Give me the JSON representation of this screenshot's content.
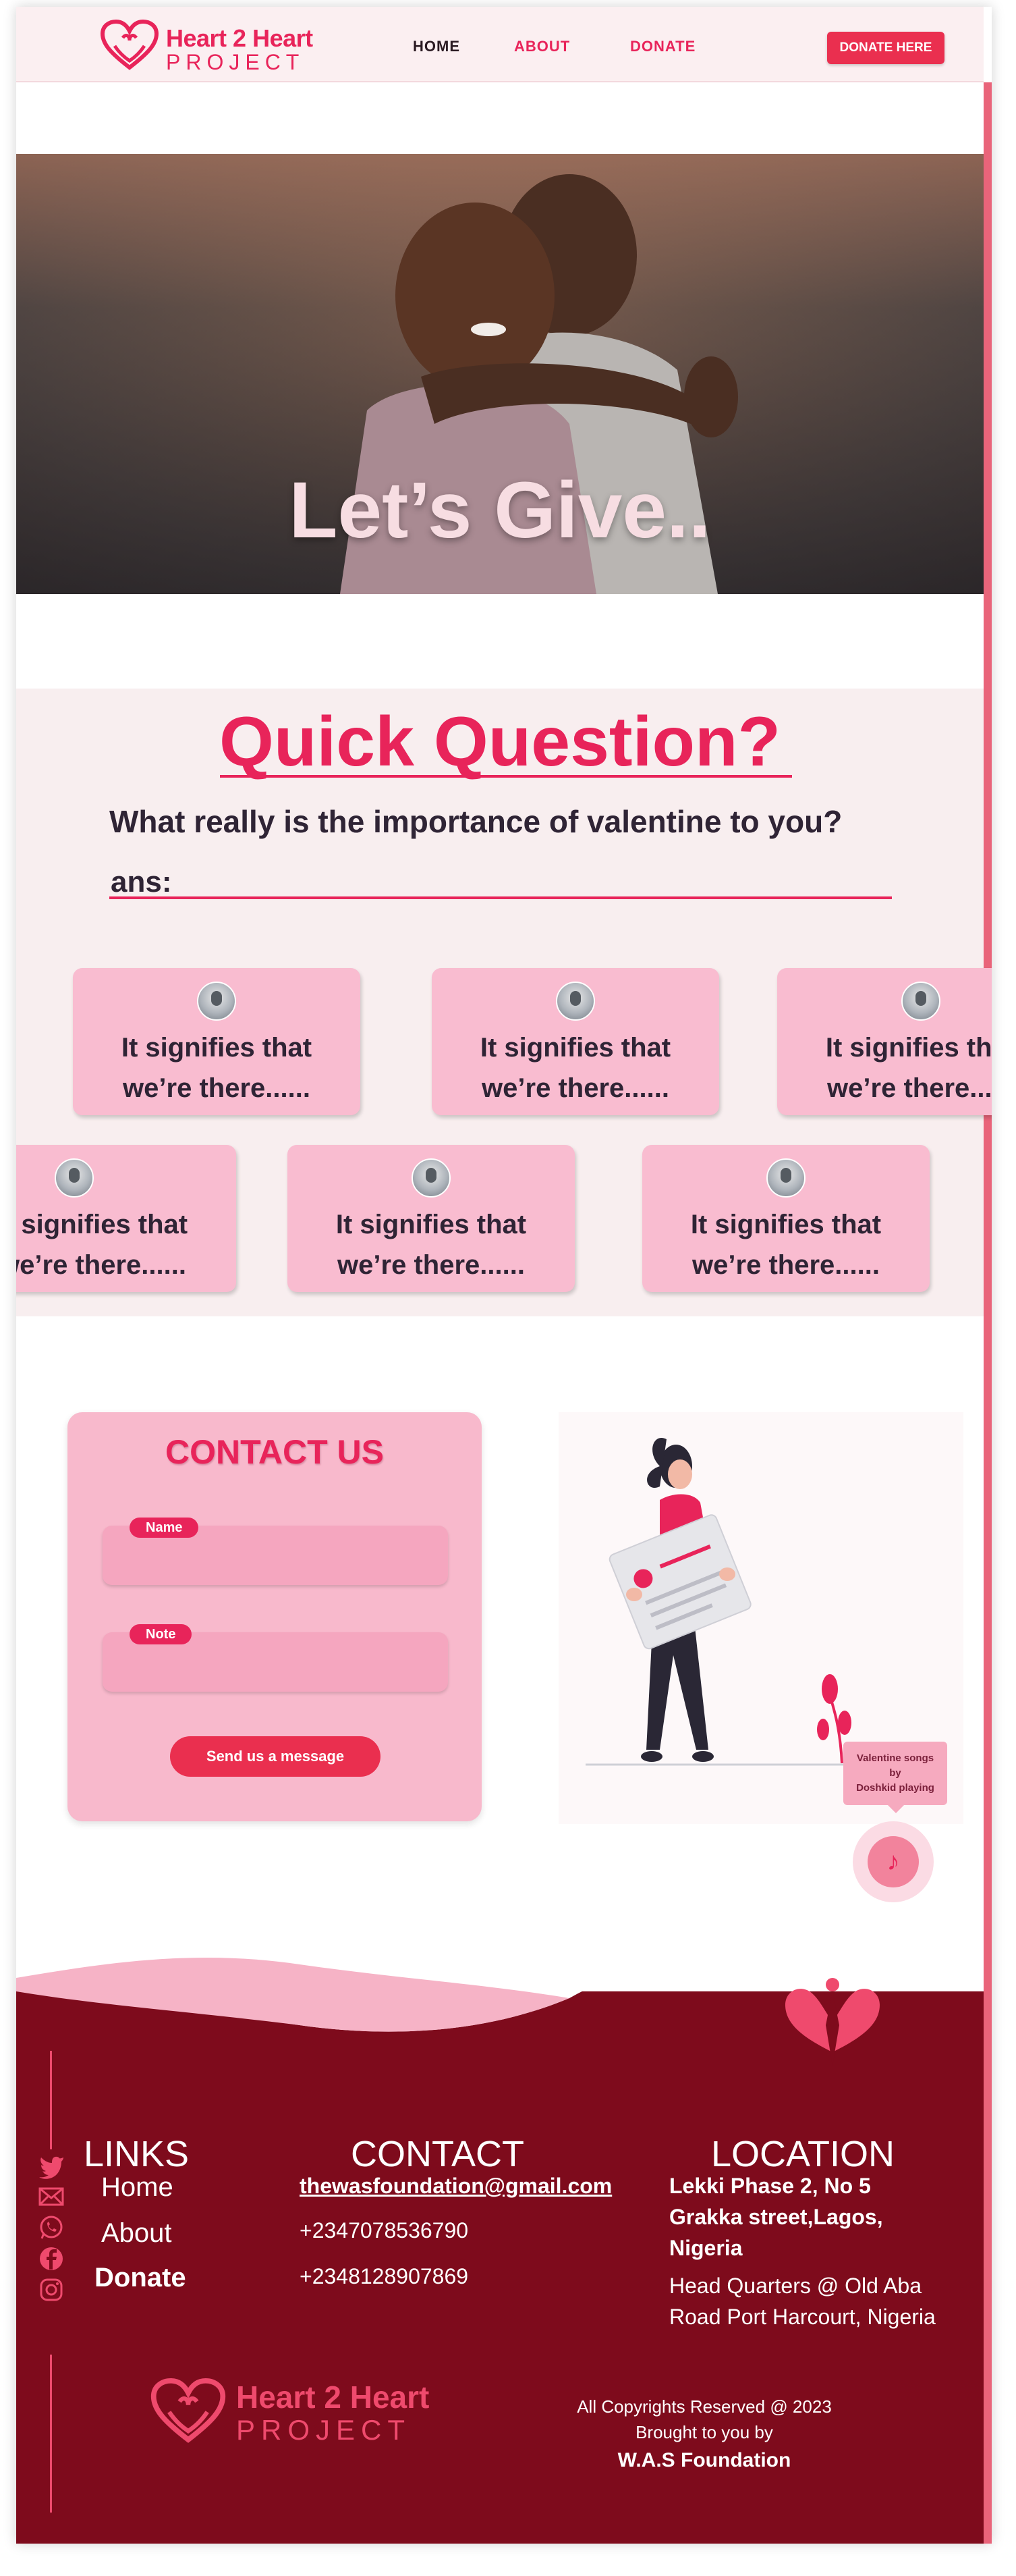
{
  "header": {
    "logo_line1": "Heart 2 Heart",
    "logo_line2": "PROJECT",
    "nav": [
      {
        "label": "HOME",
        "color": "#2a1a22"
      },
      {
        "label": "ABOUT",
        "color": "#e8245a"
      },
      {
        "label": "DONATE",
        "color": "#e8245a"
      }
    ],
    "donate_button": "DONATE HERE"
  },
  "hero": {
    "title": "Let’s Give.."
  },
  "quick_question": {
    "title": "Quick Question?",
    "question": "What really is the importance of valentine to you?",
    "answer_label": "ans:",
    "cards_row1": [
      {
        "text": "It signifies that\nwe’re there......"
      },
      {
        "text": "It signifies that\nwe’re there......"
      },
      {
        "text": "It signifies that\nwe’re there......"
      }
    ],
    "cards_row2": [
      {
        "text": "It signifies that\nwe’re there......"
      },
      {
        "text": "It signifies that\nwe’re there......"
      },
      {
        "text": "It signifies that\nwe’re there......"
      }
    ]
  },
  "contact": {
    "title": "CONTACT US",
    "name_label": "Name",
    "note_label": "Note",
    "send_button": "Send us a message"
  },
  "music_widget": {
    "line1": "Valentine songs",
    "line2": "by",
    "line3": "Doshkid  playing",
    "icon": "music-note-icon"
  },
  "footer": {
    "links_heading": "LINKS",
    "links": [
      "Home",
      "About",
      "Donate"
    ],
    "contact_heading": "CONTACT",
    "email": "thewasfoundation@gmail.com",
    "phone1": "+2347078536790",
    "phone2": "+2348128907869",
    "location_heading": "LOCATION",
    "address_line1": "Lekki Phase 2, No 5",
    "address_line2": "Grakka street,Lagos,",
    "address_line3": "Nigeria",
    "hq_line1": "Head Quarters @ Old Aba",
    "hq_line2": "Road Port Harcourt, Nigeria",
    "logo_line1": "Heart 2 Heart",
    "logo_line2": "PROJECT",
    "copyright": "All Copyrights Reserved @ 2023",
    "brought_by": "Brought to you by",
    "foundation": "W.A.S Foundation",
    "social_icons": [
      "twitter-icon",
      "email-icon",
      "whatsapp-icon",
      "facebook-icon",
      "instagram-icon"
    ]
  },
  "colors": {
    "accent": "#e8245a",
    "button": "#ea2f4f",
    "footer_bg": "#7e0b1c",
    "card_pink": "#f9bcd0",
    "section_bg": "#f8eeef"
  }
}
